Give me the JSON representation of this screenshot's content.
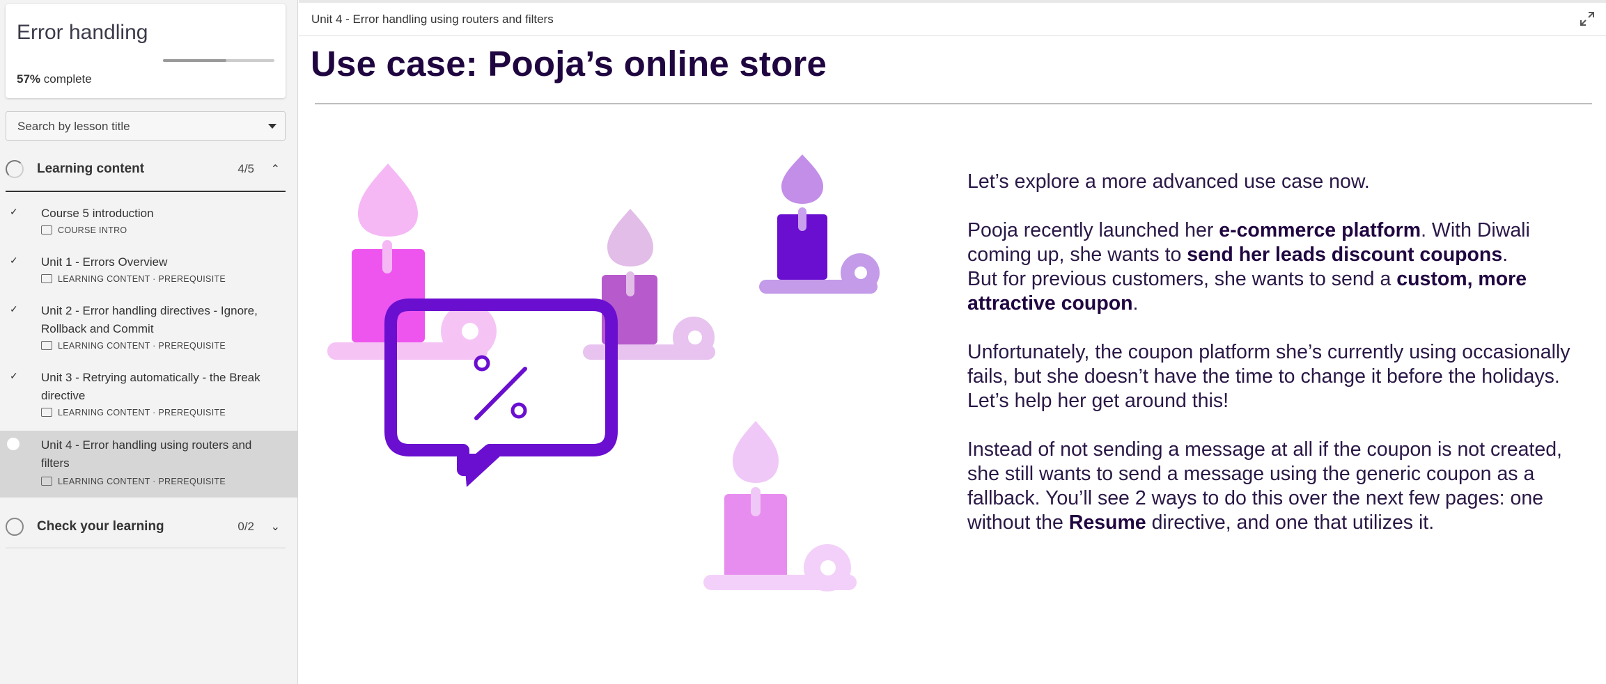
{
  "sidebar": {
    "course_title": "Error handling",
    "progress_percent": "57%",
    "progress_suffix": " complete",
    "progress_fraction": 0.57,
    "search_placeholder": "Search by lesson title",
    "sections": [
      {
        "label": "Learning content",
        "count": "4/5",
        "chevron": "chevron-up-icon"
      },
      {
        "label": "Check your learning",
        "count": "0/2",
        "chevron": "chevron-down-icon"
      }
    ],
    "lessons": [
      {
        "title": "Course 5 introduction",
        "meta": "COURSE INTRO",
        "status": "done"
      },
      {
        "title": "Unit 1 - Errors Overview",
        "meta": "LEARNING CONTENT · PREREQUISITE",
        "status": "done"
      },
      {
        "title": "Unit 2 - Error handling directives - Ignore, Rollback and Commit",
        "meta": "LEARNING CONTENT · PREREQUISITE",
        "status": "done"
      },
      {
        "title": "Unit 3 - Retrying automatically - the Break directive",
        "meta": "LEARNING CONTENT · PREREQUISITE",
        "status": "done"
      },
      {
        "title": "Unit 4 - Error handling using routers and filters",
        "meta": "LEARNING CONTENT · PREREQUISITE",
        "status": "current"
      }
    ]
  },
  "topbar": {
    "breadcrumb": "Unit 4 - Error handling using routers and filters"
  },
  "main": {
    "title": "Use case: Pooja’s online store",
    "paragraphs": {
      "p1": "Let’s explore a more advanced use case now.",
      "p2a": "Pooja recently launched her ",
      "p2b": "e-commerce platform",
      "p2c": ". With Diwali coming up, she wants to ",
      "p2d": "send her leads discount coupons",
      "p2e": ".",
      "p2f": "But for previous customers, she wants to send a ",
      "p2g": "custom, more attractive coupon",
      "p2h": ".",
      "p3": "Unfortunately, the coupon platform she’s currently using occasionally fails, but she doesn’t have the time to change it before the holidays. Let’s help her get around this!",
      "p4a": "Instead of not sending a message at all if the coupon is not created, she still wants to send a message using the generic coupon as a fallback. You’ll see 2 ways to do this over the next few pages: one without the ",
      "p4b": "Resume",
      "p4c": " directive, and one that utilizes it."
    }
  },
  "colors": {
    "title": "#200640",
    "candle_pink": "#f050f0",
    "candle_purple": "#6a0fd0",
    "bubble": "#6a0fd0"
  }
}
